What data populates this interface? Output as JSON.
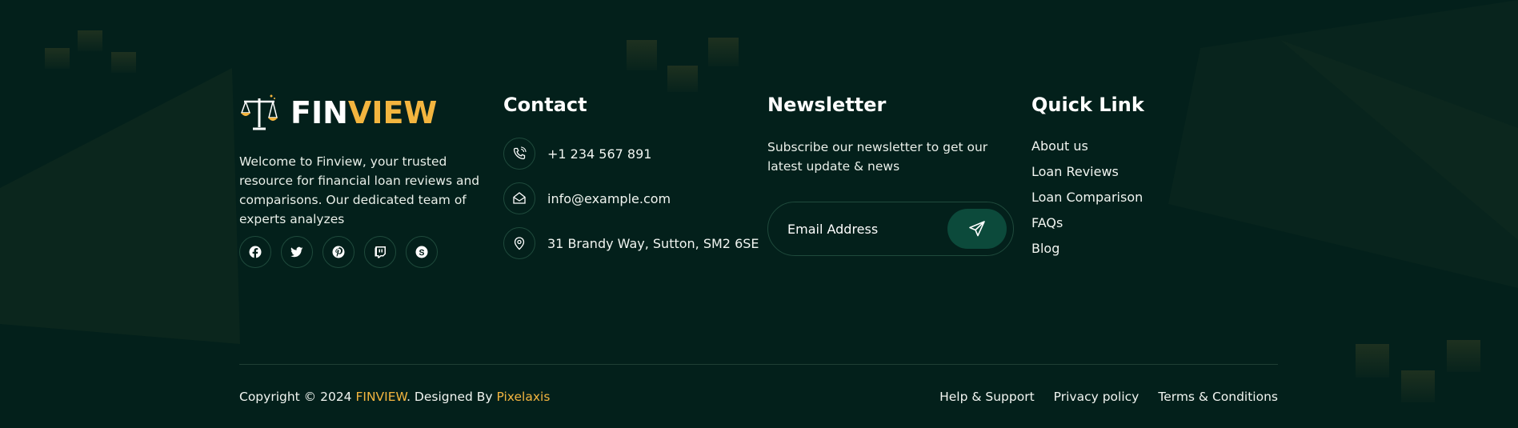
{
  "brand": {
    "name_part1": "FIN",
    "name_part2": "VIEW",
    "logo_icon": "scale-icon",
    "description": "Welcome to Finview, your trusted resource for financial loan reviews and comparisons. Our dedicated team of experts analyzes"
  },
  "socials": [
    {
      "icon": "facebook-icon"
    },
    {
      "icon": "twitter-icon"
    },
    {
      "icon": "pinterest-icon"
    },
    {
      "icon": "twitch-icon"
    },
    {
      "icon": "skype-icon"
    }
  ],
  "contact": {
    "title": "Contact",
    "phone": "+1 234 567 891",
    "email": "info@example.com",
    "address": "31 Brandy Way, Sutton, SM2 6SE"
  },
  "newsletter": {
    "title": "Newsletter",
    "description": "Subscribe our newsletter to get our latest update & news",
    "placeholder": "Email Address",
    "submit_icon": "send-icon"
  },
  "quick_links": {
    "title": "Quick Link",
    "items": [
      "About us",
      "Loan Reviews",
      "Loan Comparison",
      "FAQs",
      "Blog"
    ]
  },
  "bottom": {
    "copyright_prefix": "Copyright © 2024 ",
    "brand": "FINVIEW",
    "designed_by": ". Designed By ",
    "designer": "Pixelaxis",
    "links": [
      "Help & Support",
      "Privacy policy",
      "Terms & Conditions"
    ]
  },
  "colors": {
    "background": "#03201b",
    "accent": "#f3b53f",
    "button": "#0c4a3b",
    "border": "#1f4a3c"
  }
}
